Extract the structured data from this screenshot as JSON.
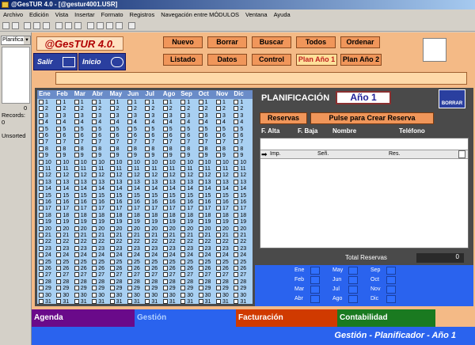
{
  "window": {
    "title": "@GesTUR 4.0 - [@gestur4001.USR]"
  },
  "menu": [
    "Archivo",
    "Edición",
    "Vista",
    "Insertar",
    "Formato",
    "Registros",
    "Navegación entre MÓDULOS",
    "Ventana",
    "Ayuda"
  ],
  "left_panel": {
    "selected": "Planifica...",
    "zero": "0",
    "records_label": "Records:",
    "records_value": "0",
    "status": "Unsorted"
  },
  "app": {
    "logo": "@GesTUR 4.0.",
    "salir": "Salir",
    "inicio": "Inicio"
  },
  "buttons": {
    "nuevo": "Nuevo",
    "borrar": "Borrar",
    "buscar": "Buscar",
    "todos": "Todos",
    "ordenar": "Ordenar",
    "listado": "Listado",
    "datos": "Datos",
    "control": "Control",
    "plan1": "Plan Año 1",
    "plan2": "Plan Año 2"
  },
  "calendar": {
    "months": [
      "Ene",
      "Feb",
      "Mar",
      "Abr",
      "May",
      "Jun",
      "Jul",
      "Ago",
      "Sep",
      "Oct",
      "Nov",
      "Dic"
    ]
  },
  "planning": {
    "title": "PLANIFICACIÓN",
    "year": "Año 1",
    "borrar": "BORRAR",
    "reservas_btn": "Reservas",
    "crear_btn": "Pulse para Crear Reserva",
    "cols": [
      "F. Alta",
      "F. Baja",
      "Nombre",
      "Teléfono"
    ],
    "row_labels": {
      "imp": "Imp.",
      "sen": "Señ.",
      "res": "Res."
    },
    "total_label": "Total Reservas",
    "total_value": "0"
  },
  "summary": {
    "months": [
      "Ene",
      "Feb",
      "Mar",
      "Abr",
      "May",
      "Jun",
      "Jul",
      "Ago",
      "Sep",
      "Oct",
      "Nov",
      "Dic"
    ]
  },
  "tabs": {
    "agenda": "Agenda",
    "gestion": "Gestión",
    "facturacion": "Facturación",
    "contabilidad": "Contabilidad"
  },
  "footer": "Gestión - Planificador -   Año 1",
  "colors": {
    "accent": "#2a3f9f",
    "panel": "#f4ba86",
    "button": "#f0965a"
  }
}
